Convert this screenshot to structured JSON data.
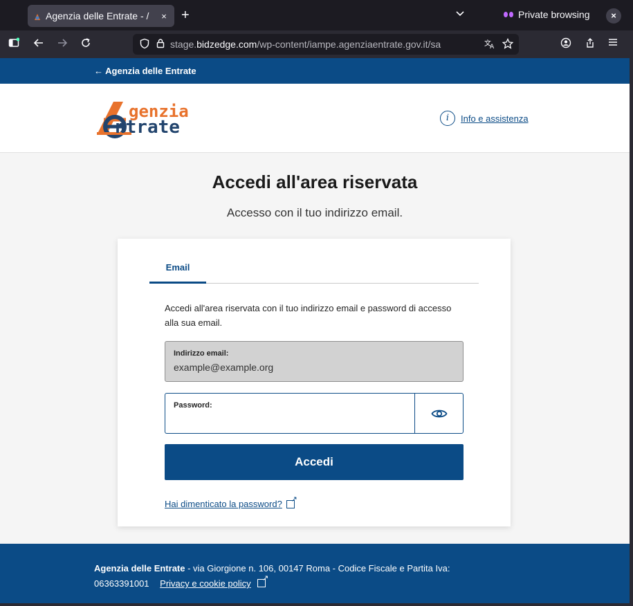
{
  "browser": {
    "tab_title": "Agenzia delle Entrate - /",
    "tab_close": "×",
    "new_tab": "+",
    "tab_list": "⌄",
    "private_label": "Private browsing",
    "window_close": "×",
    "url_pre": "stage.",
    "url_domain": "bidzedge.com",
    "url_path": "/wp-content/iampe.agenziaentrate.gov.it/sa"
  },
  "topstrip": {
    "back_label": "← Agenzia delle Entrate"
  },
  "header": {
    "logo_line1": "genzia",
    "logo_line2": "ntrate",
    "info_icon": "i",
    "info_link": "Info e assistenza"
  },
  "main": {
    "title": "Accedi all'area riservata",
    "subtitle": "Accesso con il tuo indirizzo email."
  },
  "form": {
    "tab_email": "Email",
    "description": "Accedi all'area riservata con il tuo indirizzo email e password di accesso alla sua email.",
    "email_label": "Indirizzo email:",
    "email_value": "example@example.org",
    "password_label": "Password:",
    "password_value": "",
    "submit_label": "Accedi",
    "forgot_link": "Hai dimenticato la password?"
  },
  "footer": {
    "org_name": "Agenzia delle Entrate",
    "address": " - via Giorgione n. 106, 00147 Roma - Codice Fiscale e Partita Iva:",
    "vat": "06363391001",
    "privacy_link": "Privacy e cookie policy"
  },
  "colors": {
    "brand_blue": "#0b4b86",
    "logo_orange": "#e8722c",
    "logo_navy": "#22446d"
  }
}
